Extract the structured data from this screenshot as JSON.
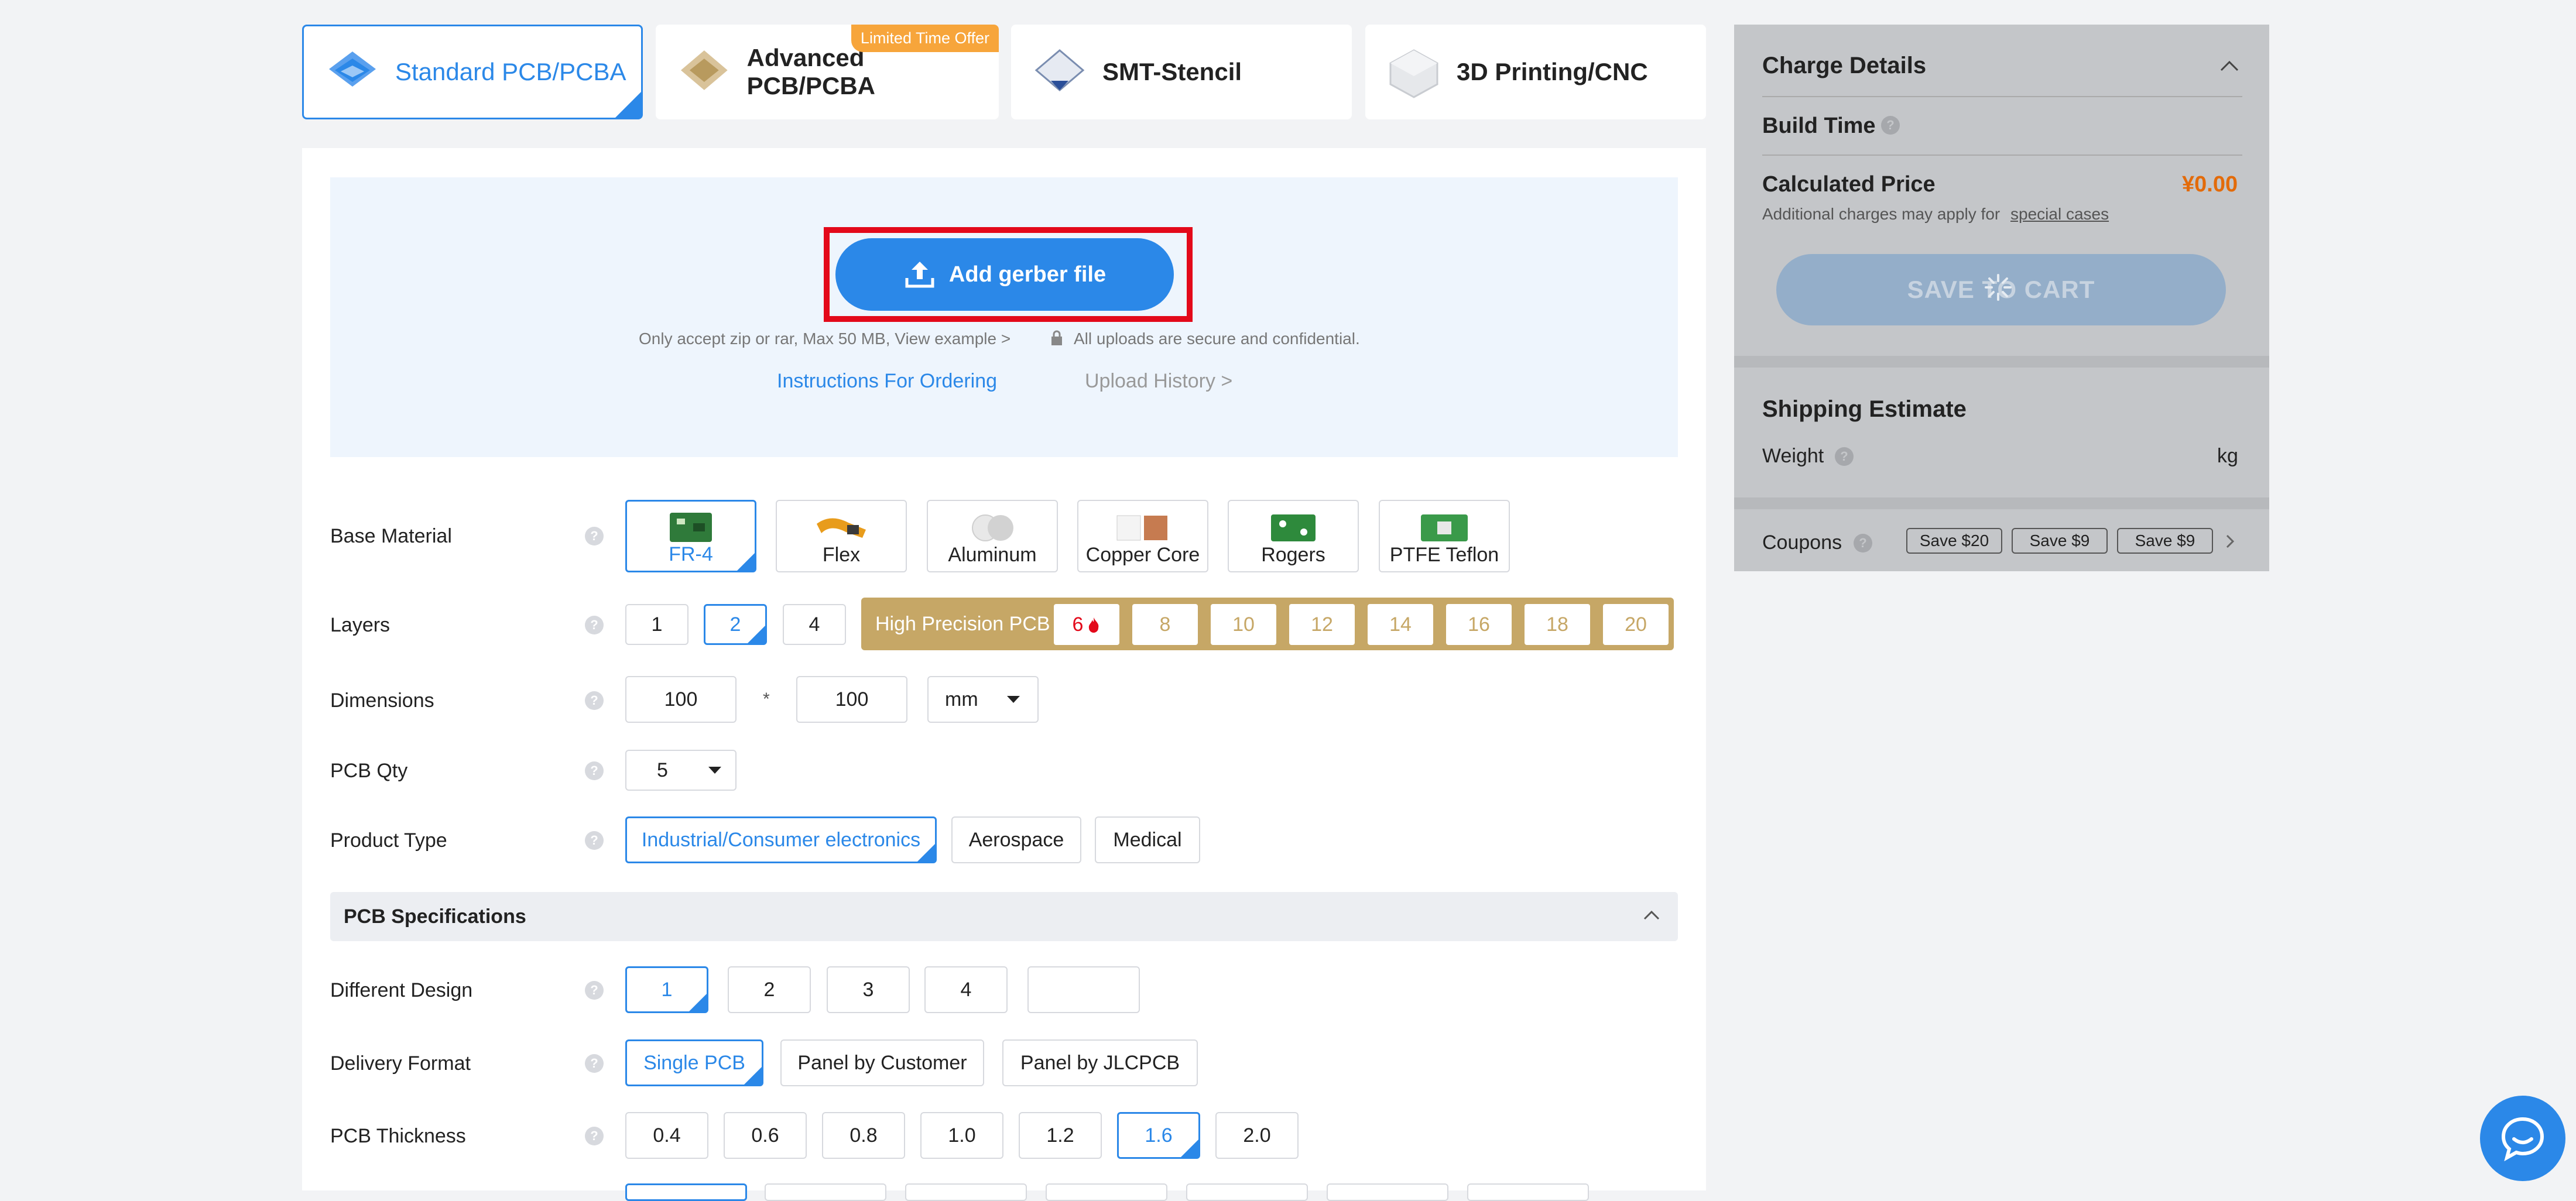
{
  "tabs": [
    {
      "label": "Standard PCB/PCBA",
      "icon": "standard-pcb-icon"
    },
    {
      "label": "Advanced PCB/PCBA",
      "icon": "advanced-pcb-icon",
      "badge": "Limited Time Offer"
    },
    {
      "label": "SMT-Stencil",
      "icon": "smt-stencil-icon"
    },
    {
      "label": "3D Printing/CNC",
      "icon": "3d-printing-icon"
    }
  ],
  "upload": {
    "button": "Add gerber file",
    "note_left": "Only accept zip or rar, Max 50 MB, View example >",
    "note_right": "All uploads are secure and confidential.",
    "instructions": "Instructions For Ordering",
    "history": "Upload History >"
  },
  "rows": {
    "base_material": {
      "label": "Base Material",
      "options": [
        "FR-4",
        "Flex",
        "Aluminum",
        "Copper Core",
        "Rogers",
        "PTFE Teflon"
      ],
      "selected": "FR-4"
    },
    "layers": {
      "label": "Layers",
      "options": [
        "1",
        "2",
        "4"
      ],
      "selected": "2",
      "high_precision_label": "High Precision PCB",
      "hp_options": [
        "6",
        "8",
        "10",
        "12",
        "14",
        "16",
        "18",
        "20"
      ]
    },
    "dimensions": {
      "label": "Dimensions",
      "width": "100",
      "height": "100",
      "separator": "*",
      "unit": "mm"
    },
    "pcb_qty": {
      "label": "PCB Qty",
      "value": "5"
    },
    "product_type": {
      "label": "Product Type",
      "options": [
        "Industrial/Consumer electronics",
        "Aerospace",
        "Medical"
      ],
      "selected": "Industrial/Consumer electronics"
    },
    "spec_header": "PCB Specifications",
    "different_design": {
      "label": "Different Design",
      "options": [
        "1",
        "2",
        "3",
        "4",
        ""
      ],
      "selected": "1"
    },
    "delivery_format": {
      "label": "Delivery Format",
      "options": [
        "Single PCB",
        "Panel by Customer",
        "Panel by JLCPCB"
      ],
      "selected": "Single PCB"
    },
    "pcb_thickness": {
      "label": "PCB Thickness",
      "options": [
        "0.4",
        "0.6",
        "0.8",
        "1.0",
        "1.2",
        "1.6",
        "2.0"
      ],
      "selected": "1.6"
    }
  },
  "charge": {
    "title": "Charge Details",
    "build_time": "Build Time",
    "calc_price": "Calculated Price",
    "price": "¥0.00",
    "additional": "Additional charges may apply for",
    "special": "special cases",
    "save_cart": "SAVE TO CART"
  },
  "shipping": {
    "title": "Shipping Estimate",
    "weight_label": "Weight",
    "weight_unit": "kg"
  },
  "coupons": {
    "label": "Coupons",
    "items": [
      "Save $20",
      "Save $9",
      "Save $9"
    ]
  },
  "colors": {
    "accent": "#2b88e8",
    "highlight": "#e3091a",
    "gold": "#c6a766",
    "price": "#e36b0a",
    "offer": "#f7a53b"
  }
}
